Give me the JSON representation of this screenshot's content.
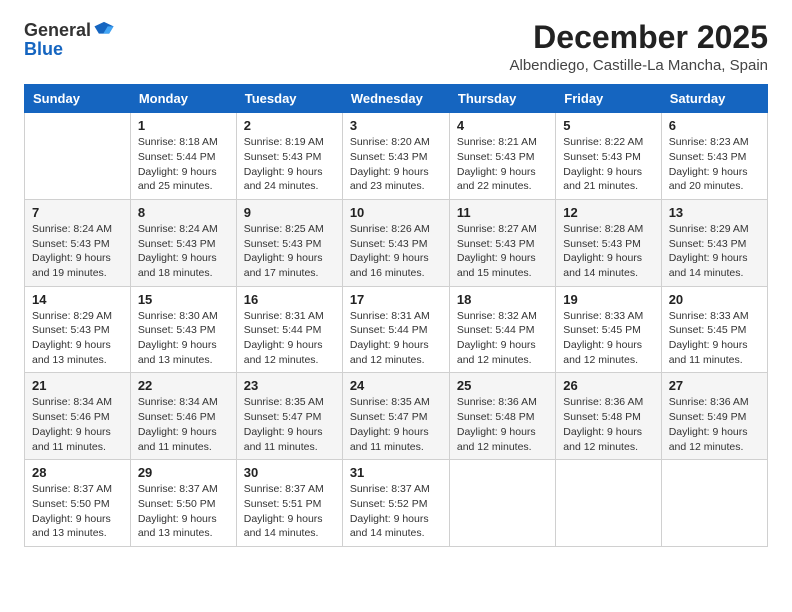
{
  "logo": {
    "general": "General",
    "blue": "Blue"
  },
  "title": "December 2025",
  "subtitle": "Albendiego, Castille-La Mancha, Spain",
  "headers": [
    "Sunday",
    "Monday",
    "Tuesday",
    "Wednesday",
    "Thursday",
    "Friday",
    "Saturday"
  ],
  "weeks": [
    [
      {
        "day": "",
        "info": ""
      },
      {
        "day": "1",
        "info": "Sunrise: 8:18 AM\nSunset: 5:44 PM\nDaylight: 9 hours\nand 25 minutes."
      },
      {
        "day": "2",
        "info": "Sunrise: 8:19 AM\nSunset: 5:43 PM\nDaylight: 9 hours\nand 24 minutes."
      },
      {
        "day": "3",
        "info": "Sunrise: 8:20 AM\nSunset: 5:43 PM\nDaylight: 9 hours\nand 23 minutes."
      },
      {
        "day": "4",
        "info": "Sunrise: 8:21 AM\nSunset: 5:43 PM\nDaylight: 9 hours\nand 22 minutes."
      },
      {
        "day": "5",
        "info": "Sunrise: 8:22 AM\nSunset: 5:43 PM\nDaylight: 9 hours\nand 21 minutes."
      },
      {
        "day": "6",
        "info": "Sunrise: 8:23 AM\nSunset: 5:43 PM\nDaylight: 9 hours\nand 20 minutes."
      }
    ],
    [
      {
        "day": "7",
        "info": "Sunrise: 8:24 AM\nSunset: 5:43 PM\nDaylight: 9 hours\nand 19 minutes."
      },
      {
        "day": "8",
        "info": "Sunrise: 8:24 AM\nSunset: 5:43 PM\nDaylight: 9 hours\nand 18 minutes."
      },
      {
        "day": "9",
        "info": "Sunrise: 8:25 AM\nSunset: 5:43 PM\nDaylight: 9 hours\nand 17 minutes."
      },
      {
        "day": "10",
        "info": "Sunrise: 8:26 AM\nSunset: 5:43 PM\nDaylight: 9 hours\nand 16 minutes."
      },
      {
        "day": "11",
        "info": "Sunrise: 8:27 AM\nSunset: 5:43 PM\nDaylight: 9 hours\nand 15 minutes."
      },
      {
        "day": "12",
        "info": "Sunrise: 8:28 AM\nSunset: 5:43 PM\nDaylight: 9 hours\nand 14 minutes."
      },
      {
        "day": "13",
        "info": "Sunrise: 8:29 AM\nSunset: 5:43 PM\nDaylight: 9 hours\nand 14 minutes."
      }
    ],
    [
      {
        "day": "14",
        "info": "Sunrise: 8:29 AM\nSunset: 5:43 PM\nDaylight: 9 hours\nand 13 minutes."
      },
      {
        "day": "15",
        "info": "Sunrise: 8:30 AM\nSunset: 5:43 PM\nDaylight: 9 hours\nand 13 minutes."
      },
      {
        "day": "16",
        "info": "Sunrise: 8:31 AM\nSunset: 5:44 PM\nDaylight: 9 hours\nand 12 minutes."
      },
      {
        "day": "17",
        "info": "Sunrise: 8:31 AM\nSunset: 5:44 PM\nDaylight: 9 hours\nand 12 minutes."
      },
      {
        "day": "18",
        "info": "Sunrise: 8:32 AM\nSunset: 5:44 PM\nDaylight: 9 hours\nand 12 minutes."
      },
      {
        "day": "19",
        "info": "Sunrise: 8:33 AM\nSunset: 5:45 PM\nDaylight: 9 hours\nand 12 minutes."
      },
      {
        "day": "20",
        "info": "Sunrise: 8:33 AM\nSunset: 5:45 PM\nDaylight: 9 hours\nand 11 minutes."
      }
    ],
    [
      {
        "day": "21",
        "info": "Sunrise: 8:34 AM\nSunset: 5:46 PM\nDaylight: 9 hours\nand 11 minutes."
      },
      {
        "day": "22",
        "info": "Sunrise: 8:34 AM\nSunset: 5:46 PM\nDaylight: 9 hours\nand 11 minutes."
      },
      {
        "day": "23",
        "info": "Sunrise: 8:35 AM\nSunset: 5:47 PM\nDaylight: 9 hours\nand 11 minutes."
      },
      {
        "day": "24",
        "info": "Sunrise: 8:35 AM\nSunset: 5:47 PM\nDaylight: 9 hours\nand 11 minutes."
      },
      {
        "day": "25",
        "info": "Sunrise: 8:36 AM\nSunset: 5:48 PM\nDaylight: 9 hours\nand 12 minutes."
      },
      {
        "day": "26",
        "info": "Sunrise: 8:36 AM\nSunset: 5:48 PM\nDaylight: 9 hours\nand 12 minutes."
      },
      {
        "day": "27",
        "info": "Sunrise: 8:36 AM\nSunset: 5:49 PM\nDaylight: 9 hours\nand 12 minutes."
      }
    ],
    [
      {
        "day": "28",
        "info": "Sunrise: 8:37 AM\nSunset: 5:50 PM\nDaylight: 9 hours\nand 13 minutes."
      },
      {
        "day": "29",
        "info": "Sunrise: 8:37 AM\nSunset: 5:50 PM\nDaylight: 9 hours\nand 13 minutes."
      },
      {
        "day": "30",
        "info": "Sunrise: 8:37 AM\nSunset: 5:51 PM\nDaylight: 9 hours\nand 14 minutes."
      },
      {
        "day": "31",
        "info": "Sunrise: 8:37 AM\nSunset: 5:52 PM\nDaylight: 9 hours\nand 14 minutes."
      },
      {
        "day": "",
        "info": ""
      },
      {
        "day": "",
        "info": ""
      },
      {
        "day": "",
        "info": ""
      }
    ]
  ]
}
